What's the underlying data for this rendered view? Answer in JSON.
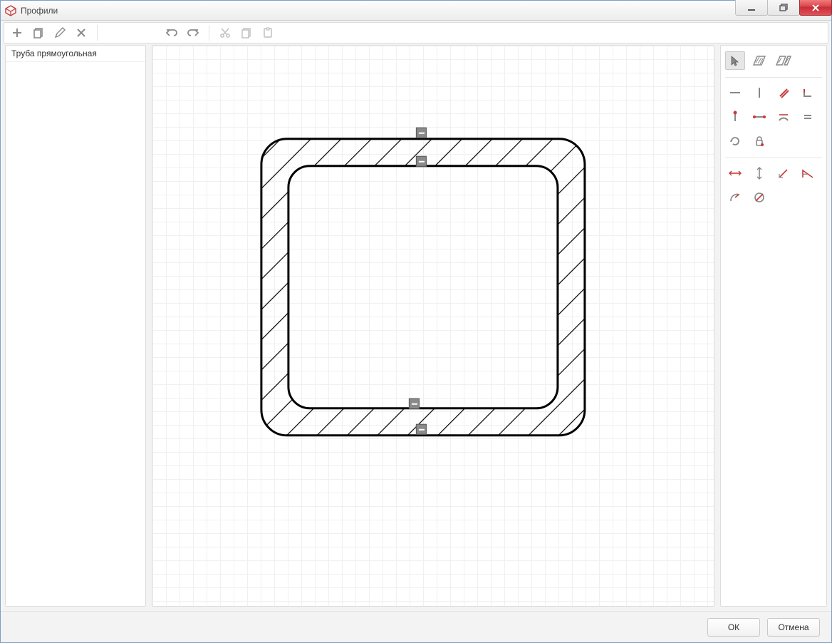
{
  "window": {
    "title": "Профили"
  },
  "sidebar": {
    "items": [
      {
        "label": "Труба прямоугольная",
        "selected": true
      }
    ]
  },
  "toolbar": {
    "add": "add",
    "duplicate": "duplicate",
    "edit": "edit",
    "delete": "delete",
    "undo": "undo",
    "redo": "redo",
    "cut": "cut",
    "copy": "copy",
    "paste": "paste"
  },
  "tools": {
    "mode": [
      "select",
      "hatch-outer",
      "hatch-inner"
    ],
    "draw": [
      "line-horizontal",
      "line-vertical",
      "line-diagonal",
      "corner"
    ],
    "constraint": [
      "point",
      "segment-point",
      "arc",
      "equal"
    ],
    "misc": [
      "sync",
      "lock"
    ],
    "dim": [
      "dim-horizontal",
      "dim-vertical",
      "dim-aligned",
      "dim-angle"
    ],
    "arc": [
      "arc-radius",
      "arc-diameter"
    ]
  },
  "footer": {
    "ok": "ОК",
    "cancel": "Отмена"
  }
}
